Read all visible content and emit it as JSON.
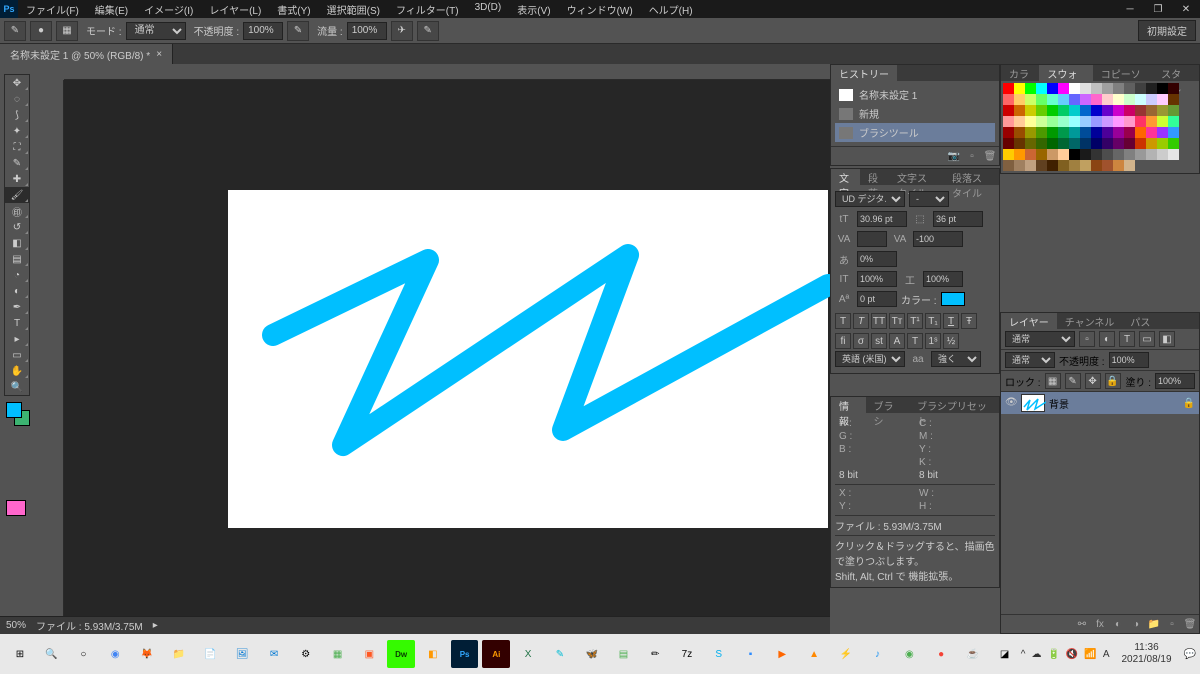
{
  "menu": {
    "file": "ファイル(F)",
    "edit": "編集(E)",
    "image": "イメージ(I)",
    "layer": "レイヤー(L)",
    "type": "書式(Y)",
    "select": "選択範囲(S)",
    "filter": "フィルター(T)",
    "3d": "3D(D)",
    "view": "表示(V)",
    "window": "ウィンドウ(W)",
    "help": "ヘルプ(H)"
  },
  "options": {
    "mode_label": "モード :",
    "mode_value": "通常",
    "opacity_label": "不透明度 :",
    "opacity_value": "100%",
    "flow_label": "流量 :",
    "flow_value": "100%",
    "right_button": "初期設定"
  },
  "doctab": {
    "title": "名称未設定 1 @ 50% (RGB/8) *"
  },
  "history": {
    "tab": "ヒストリー",
    "doc_name": "名称未設定 1",
    "items": [
      "新規",
      "ブラシツール"
    ]
  },
  "character": {
    "tabs": [
      "文字",
      "段落",
      "文字スタイル",
      "段落スタイル"
    ],
    "font": "UD デジタル ...",
    "size": "30.96 pt",
    "leading": "36 pt",
    "va": "VA",
    "tracking": "-100",
    "a_pct": "0%",
    "scale_h": "100%",
    "scale_v": "100%",
    "baseline": "0 pt",
    "color_label": "カラー :",
    "lang": "英語 (米国)",
    "aa": "強く",
    "aa_label": "aa"
  },
  "info": {
    "tabs": [
      "情報",
      "ブラシ",
      "ブラシプリセット"
    ],
    "r": "R :",
    "g": "G :",
    "b": "B :",
    "c": "C :",
    "m": "M :",
    "y": "Y :",
    "k": "K :",
    "bit": "8 bit",
    "bit2": "8 bit",
    "x": "X :",
    "y2": "Y :",
    "w": "W :",
    "h": "H :",
    "file_label": "ファイル :",
    "file_val": "5.93M/3.75M",
    "hint1": "クリック＆ドラッグすると、描画色 で塗りつぶします。",
    "hint2": "Shift, Alt, Ctrl で 機能拡張。"
  },
  "swatches": {
    "tabs": [
      "カラー",
      "スウォッチ",
      "コピーソース",
      "スタイル"
    ]
  },
  "layers": {
    "tabs": [
      "レイヤー",
      "チャンネル",
      "パス"
    ],
    "mode": "通常",
    "opacity_label": "不透明度 :",
    "opacity": "100%",
    "lock_label": "ロック :",
    "fill_label": "塗り :",
    "fill": "100%",
    "bg_name": "背景"
  },
  "status": {
    "zoom": "50%",
    "file": "ファイル : 5.93M/3.75M"
  },
  "taskbar": {
    "time": "11:36",
    "date": "2021/08/19"
  },
  "swatch_colors": [
    "#ff0000",
    "#ffff00",
    "#00ff00",
    "#00ffff",
    "#0000ff",
    "#ff00ff",
    "#ffffff",
    "#e0e0e0",
    "#c0c0c0",
    "#a0a0a0",
    "#808080",
    "#606060",
    "#404040",
    "#202020",
    "#000000",
    "#330000",
    "#ff6666",
    "#ffcc66",
    "#ccff66",
    "#66ff66",
    "#66ffcc",
    "#66ccff",
    "#6666ff",
    "#cc66ff",
    "#ff66cc",
    "#ffcccc",
    "#ffffcc",
    "#ccffcc",
    "#ccffff",
    "#ccccff",
    "#ffccff",
    "#663300",
    "#cc0000",
    "#cc6600",
    "#cccc00",
    "#66cc00",
    "#00cc00",
    "#00cc66",
    "#00cccc",
    "#0066cc",
    "#0000cc",
    "#6600cc",
    "#cc00cc",
    "#cc0066",
    "#993333",
    "#996633",
    "#999933",
    "#669933",
    "#ff9999",
    "#ffcc99",
    "#ffff99",
    "#ccff99",
    "#99ff99",
    "#99ffcc",
    "#99ffff",
    "#99ccff",
    "#9999ff",
    "#cc99ff",
    "#ff99ff",
    "#ff99cc",
    "#ff3366",
    "#ff9933",
    "#ccff33",
    "#33ff99",
    "#990000",
    "#994c00",
    "#999900",
    "#4c9900",
    "#009900",
    "#00994c",
    "#009999",
    "#004c99",
    "#000099",
    "#4c0099",
    "#990099",
    "#99004c",
    "#ff6600",
    "#ff3399",
    "#9933ff",
    "#3399ff",
    "#660000",
    "#663300",
    "#666600",
    "#336600",
    "#006600",
    "#006633",
    "#006666",
    "#003366",
    "#000066",
    "#330066",
    "#660066",
    "#660033",
    "#cc3300",
    "#cc9900",
    "#99cc00",
    "#33cc00",
    "#ffcc00",
    "#ff9900",
    "#cc6633",
    "#996600",
    "#cc9966",
    "#ffcc99",
    "#000000",
    "#1a1a1a",
    "#333333",
    "#4d4d4d",
    "#666666",
    "#808080",
    "#999999",
    "#b3b3b3",
    "#cccccc",
    "#e6e6e6",
    "#806040",
    "#a08060",
    "#c0a080",
    "#604020",
    "#402000",
    "#806020",
    "#a08040",
    "#c0a060",
    "#8b4513",
    "#a0522d",
    "#cd853f",
    "#d2b48c"
  ]
}
